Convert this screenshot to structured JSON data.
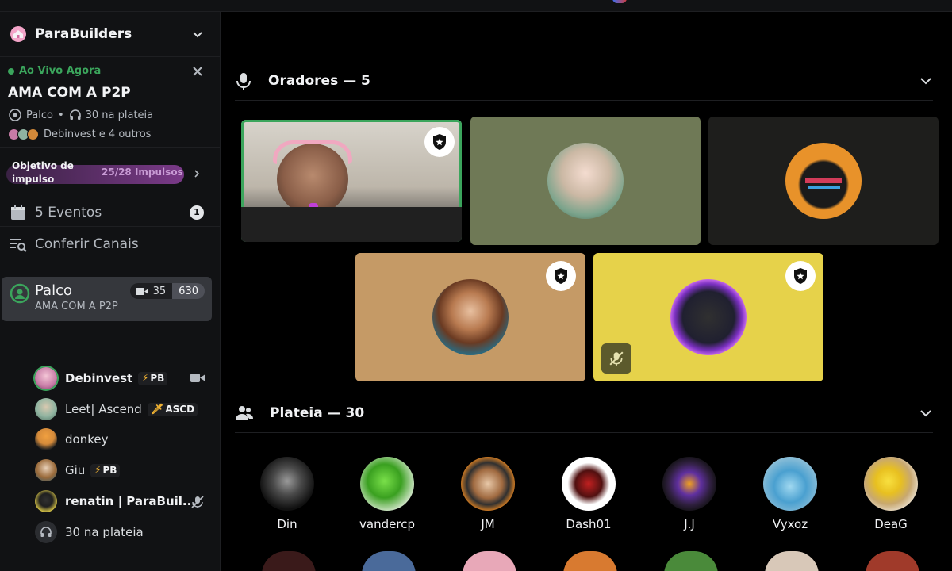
{
  "server": {
    "name": "ParaBuilders"
  },
  "live": {
    "status": "Ao Vivo Agora",
    "title": "AMA COM A P2P",
    "type": "Palco",
    "audience": "30 na plateia",
    "participants": "Debinvest e 4 outros"
  },
  "boost": {
    "label": "Objetivo de impulso",
    "count": "25/28 Impulsos",
    "progress": 0.893
  },
  "nav": {
    "events": {
      "label": "5 Eventos",
      "badge": "1"
    },
    "channels": {
      "label": "Conferir Canais"
    }
  },
  "stage_channel": {
    "name": "Palco",
    "subtitle": "AMA COM A P2P",
    "video_count": "35",
    "listener_count": "630"
  },
  "members": [
    {
      "name": "Debinvest",
      "tag": "PB"
    },
    {
      "name": "Leet| Ascend",
      "tag": "ASCD"
    },
    {
      "name": "donkey"
    },
    {
      "name": "Giu",
      "tag": "PB"
    },
    {
      "name": "renatin | ParaBuil..."
    },
    {
      "name": "30 na plateia"
    }
  ],
  "speakers": {
    "title": "Oradores — 5"
  },
  "audience": {
    "title": "Plateia — 30",
    "people": [
      "Din",
      "vandercp",
      "JM",
      "Dash01",
      "J.J",
      "Vyxoz",
      "DeaG"
    ]
  },
  "colors": {
    "accent_green": "#3ba55c",
    "background": "#000000",
    "sidebar": "#111214"
  }
}
